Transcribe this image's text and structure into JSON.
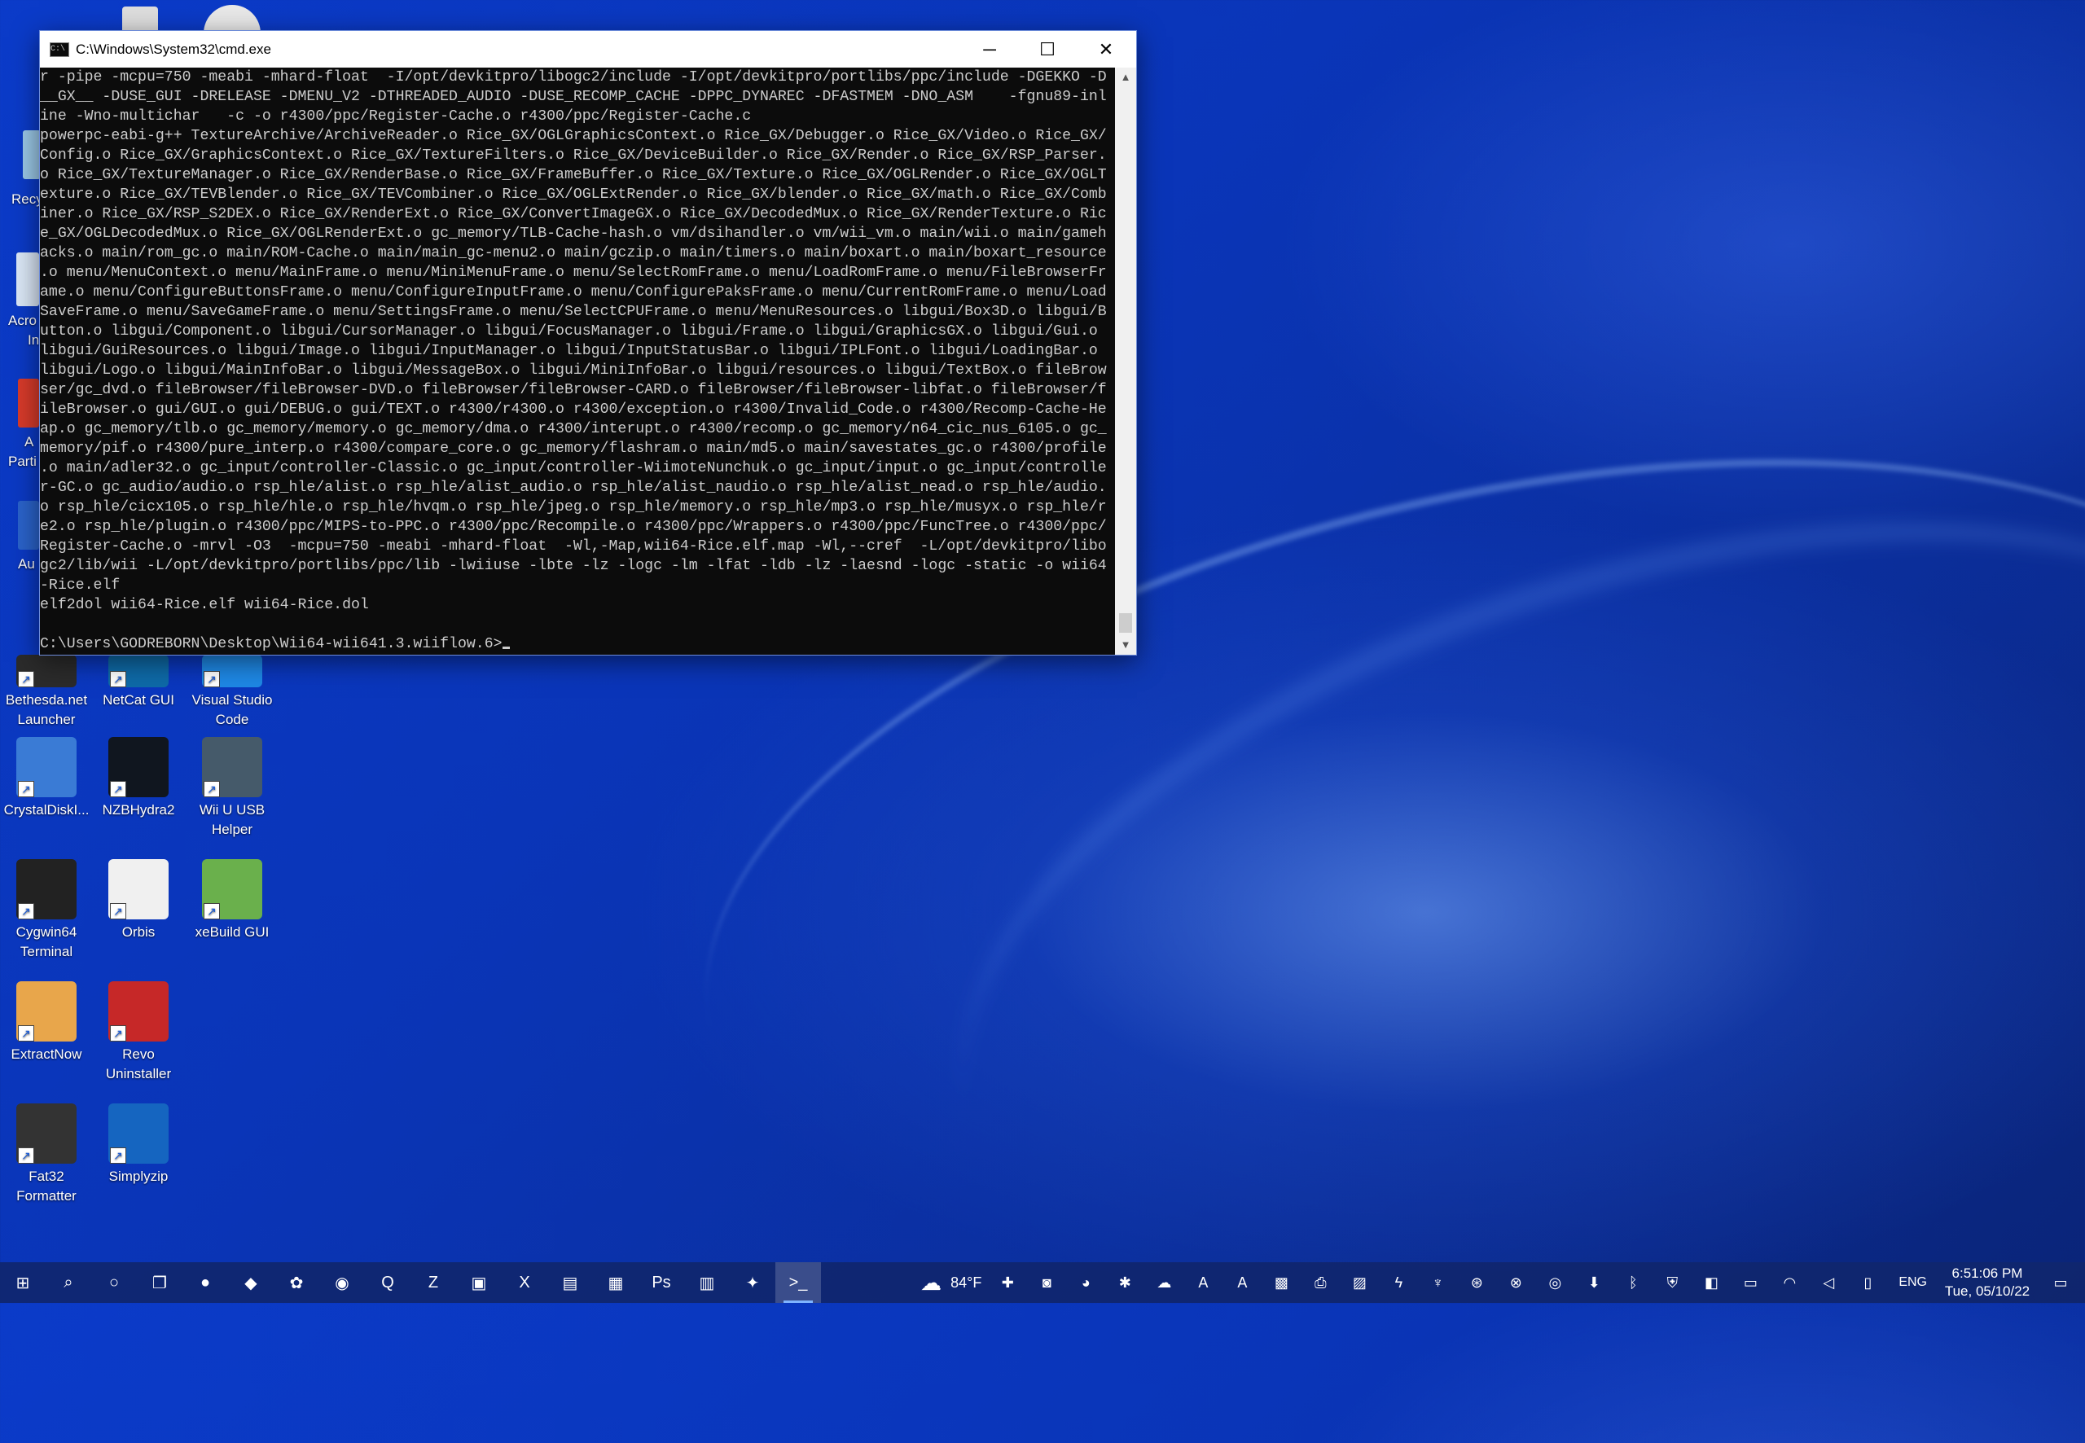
{
  "colors": {
    "desktop": "#0b3bc9",
    "taskbar": "#10266e",
    "console_bg": "#0c0c0c",
    "console_text": "#cccccc"
  },
  "desktop_icons": [
    {
      "label": "Bethesda.net\nLauncher",
      "icon": "bethesda-icon",
      "color": "#2b2b2b"
    },
    {
      "label": "NetCat GUI",
      "icon": "netcat-icon",
      "color": "#0e6aa8"
    },
    {
      "label": "Visual Studio\nCode",
      "icon": "vscode-icon",
      "color": "#1e88e5"
    },
    {
      "label": "CrystalDiskI...",
      "icon": "crystaldisk-icon",
      "color": "#3a7bd5"
    },
    {
      "label": "NZBHydra2",
      "icon": "nzbhydra-icon",
      "color": "#10161f"
    },
    {
      "label": "Wii U USB\nHelper",
      "icon": "wiiu-helper-icon",
      "color": "#455a6a"
    },
    {
      "label": "Cygwin64\nTerminal",
      "icon": "cygwin-icon",
      "color": "#222"
    },
    {
      "label": "Orbis",
      "icon": "orbis-icon",
      "color": "#f0f0f0"
    },
    {
      "label": "xeBuild GUI",
      "icon": "xebuild-icon",
      "color": "#6ab04c"
    },
    {
      "label": "ExtractNow",
      "icon": "extractnow-icon",
      "color": "#e8a64b"
    },
    {
      "label": "Revo\nUninstaller",
      "icon": "revo-icon",
      "color": "#c62828"
    },
    {
      "label": "Fat32\nFormatter",
      "icon": "fat32-icon",
      "color": "#333"
    },
    {
      "label": "Simplyzip",
      "icon": "simplyzip-icon",
      "color": "#1565c0"
    }
  ],
  "partial_labels": [
    "Recy",
    "Acro",
    "In",
    "A",
    "Parti",
    "Au"
  ],
  "window": {
    "title": "C:\\Windows\\System32\\cmd.exe",
    "minimize": "─",
    "maximize": "☐",
    "close": "✕",
    "scroll_up": "▲",
    "scroll_down": "▼"
  },
  "console_lines": [
    "r -pipe -mcpu=750 -meabi -mhard-float  -I/opt/devkitpro/libogc2/include -I/opt/devkitpro/portlibs/ppc/include -DGEKKO -D",
    "__GX__ -DUSE_GUI -DRELEASE -DMENU_V2 -DTHREADED_AUDIO -DUSE_RECOMP_CACHE -DPPC_DYNAREC -DFASTMEM -DNO_ASM    -fgnu89-inl",
    "ine -Wno-multichar   -c -o r4300/ppc/Register-Cache.o r4300/ppc/Register-Cache.c",
    "powerpc-eabi-g++ TextureArchive/ArchiveReader.o Rice_GX/OGLGraphicsContext.o Rice_GX/Debugger.o Rice_GX/Video.o Rice_GX/",
    "Config.o Rice_GX/GraphicsContext.o Rice_GX/TextureFilters.o Rice_GX/DeviceBuilder.o Rice_GX/Render.o Rice_GX/RSP_Parser.",
    "o Rice_GX/TextureManager.o Rice_GX/RenderBase.o Rice_GX/FrameBuffer.o Rice_GX/Texture.o Rice_GX/OGLRender.o Rice_GX/OGLT",
    "exture.o Rice_GX/TEVBlender.o Rice_GX/TEVCombiner.o Rice_GX/OGLExtRender.o Rice_GX/blender.o Rice_GX/math.o Rice_GX/Comb",
    "iner.o Rice_GX/RSP_S2DEX.o Rice_GX/RenderExt.o Rice_GX/ConvertImageGX.o Rice_GX/DecodedMux.o Rice_GX/RenderTexture.o Ric",
    "e_GX/OGLDecodedMux.o Rice_GX/OGLRenderExt.o gc_memory/TLB-Cache-hash.o vm/dsihandler.o vm/wii_vm.o main/wii.o main/gameh",
    "acks.o main/rom_gc.o main/ROM-Cache.o main/main_gc-menu2.o main/gczip.o main/timers.o main/boxart.o main/boxart_resource",
    ".o menu/MenuContext.o menu/MainFrame.o menu/MiniMenuFrame.o menu/SelectRomFrame.o menu/LoadRomFrame.o menu/FileBrowserFr",
    "ame.o menu/ConfigureButtonsFrame.o menu/ConfigureInputFrame.o menu/ConfigurePaksFrame.o menu/CurrentRomFrame.o menu/Load",
    "SaveFrame.o menu/SaveGameFrame.o menu/SettingsFrame.o menu/SelectCPUFrame.o menu/MenuResources.o libgui/Box3D.o libgui/B",
    "utton.o libgui/Component.o libgui/CursorManager.o libgui/FocusManager.o libgui/Frame.o libgui/GraphicsGX.o libgui/Gui.o",
    "libgui/GuiResources.o libgui/Image.o libgui/InputManager.o libgui/InputStatusBar.o libgui/IPLFont.o libgui/LoadingBar.o",
    "libgui/Logo.o libgui/MainInfoBar.o libgui/MessageBox.o libgui/MiniInfoBar.o libgui/resources.o libgui/TextBox.o fileBrow",
    "ser/gc_dvd.o fileBrowser/fileBrowser-DVD.o fileBrowser/fileBrowser-CARD.o fileBrowser/fileBrowser-libfat.o fileBrowser/f",
    "ileBrowser.o gui/GUI.o gui/DEBUG.o gui/TEXT.o r4300/r4300.o r4300/exception.o r4300/Invalid_Code.o r4300/Recomp-Cache-He",
    "ap.o gc_memory/tlb.o gc_memory/memory.o gc_memory/dma.o r4300/interupt.o r4300/recomp.o gc_memory/n64_cic_nus_6105.o gc_",
    "memory/pif.o r4300/pure_interp.o r4300/compare_core.o gc_memory/flashram.o main/md5.o main/savestates_gc.o r4300/profile",
    ".o main/adler32.o gc_input/controller-Classic.o gc_input/controller-WiimoteNunchuk.o gc_input/input.o gc_input/controlle",
    "r-GC.o gc_audio/audio.o rsp_hle/alist.o rsp_hle/alist_audio.o rsp_hle/alist_naudio.o rsp_hle/alist_nead.o rsp_hle/audio.",
    "o rsp_hle/cicx105.o rsp_hle/hle.o rsp_hle/hvqm.o rsp_hle/jpeg.o rsp_hle/memory.o rsp_hle/mp3.o rsp_hle/musyx.o rsp_hle/r",
    "e2.o rsp_hle/plugin.o r4300/ppc/MIPS-to-PPC.o r4300/ppc/Recompile.o r4300/ppc/Wrappers.o r4300/ppc/FuncTree.o r4300/ppc/",
    "Register-Cache.o -mrvl -O3  -mcpu=750 -meabi -mhard-float  -Wl,-Map,wii64-Rice.elf.map -Wl,--cref  -L/opt/devkitpro/libo",
    "gc2/lib/wii -L/opt/devkitpro/portlibs/ppc/lib -lwiiuse -lbte -lz -logc -lm -lfat -ldb -lz -laesnd -logc -static -o wii64",
    "-Rice.elf",
    "elf2dol wii64-Rice.elf wii64-Rice.dol",
    "",
    "C:\\Users\\GODREBORN\\Desktop\\Wii64-wii641.3.wiiflow.6>"
  ],
  "taskbar": {
    "apps": [
      {
        "icon": "windows-start-icon",
        "glyph": "⊞"
      },
      {
        "icon": "search-icon",
        "glyph": "⌕"
      },
      {
        "icon": "cortana-icon",
        "glyph": "○"
      },
      {
        "icon": "task-view-icon",
        "glyph": "❐"
      },
      {
        "icon": "firefox-icon",
        "glyph": "●"
      },
      {
        "icon": "edge-icon",
        "glyph": "◆"
      },
      {
        "icon": "app-icon",
        "glyph": "✿"
      },
      {
        "icon": "chrome-icon",
        "glyph": "◉"
      },
      {
        "icon": "qbittorrent-icon",
        "glyph": "Q"
      },
      {
        "icon": "filezilla-icon",
        "glyph": "Z"
      },
      {
        "icon": "window-app-icon",
        "glyph": "▣"
      },
      {
        "icon": "excel-icon",
        "glyph": "X"
      },
      {
        "icon": "sheet-icon",
        "glyph": "▤"
      },
      {
        "icon": "app-icon",
        "glyph": "▦"
      },
      {
        "icon": "photoshop-icon",
        "glyph": "Ps"
      },
      {
        "icon": "calculator-icon",
        "glyph": "▥"
      },
      {
        "icon": "app-icon",
        "glyph": "✦"
      },
      {
        "icon": "cmd-icon",
        "glyph": ">_",
        "active": true
      }
    ],
    "weather": "84°F",
    "tray": [
      {
        "icon": "weather-cloud-icon",
        "glyph": "☁"
      },
      {
        "icon": "app-tray-icon",
        "glyph": "✚"
      },
      {
        "icon": "nvidia-icon",
        "glyph": "◙"
      },
      {
        "icon": "discord-icon",
        "glyph": "◕"
      },
      {
        "icon": "tray-icon",
        "glyph": "✱"
      },
      {
        "icon": "onedrive-icon",
        "glyph": "☁"
      },
      {
        "icon": "adobe-icon",
        "glyph": "A"
      },
      {
        "icon": "font-icon",
        "glyph": "A"
      },
      {
        "icon": "app-tray-icon",
        "glyph": "▩"
      },
      {
        "icon": "printer-icon",
        "glyph": "⎙"
      },
      {
        "icon": "app-tray-icon",
        "glyph": "▨"
      },
      {
        "icon": "lightning-icon",
        "glyph": "ϟ"
      },
      {
        "icon": "app-tray-icon",
        "glyph": "♆"
      },
      {
        "icon": "steam-icon",
        "glyph": "⊛"
      },
      {
        "icon": "xbox-icon",
        "glyph": "⊗"
      },
      {
        "icon": "app-tray-icon",
        "glyph": "◎"
      },
      {
        "icon": "download-icon",
        "glyph": "⬇"
      },
      {
        "icon": "bluetooth-icon",
        "glyph": "ᛒ"
      },
      {
        "icon": "security-shield-icon",
        "glyph": "⛨"
      },
      {
        "icon": "app-tray-icon",
        "glyph": "◧"
      },
      {
        "icon": "battery-icon",
        "glyph": "▭"
      },
      {
        "icon": "wifi-icon",
        "glyph": "◠"
      },
      {
        "icon": "volume-icon",
        "glyph": "◁"
      },
      {
        "icon": "pen-icon",
        "glyph": "▯"
      }
    ],
    "language": "ENG",
    "time": "6:51:06 PM",
    "date": "Tue, 05/10/22",
    "notification_glyph": "▭"
  }
}
